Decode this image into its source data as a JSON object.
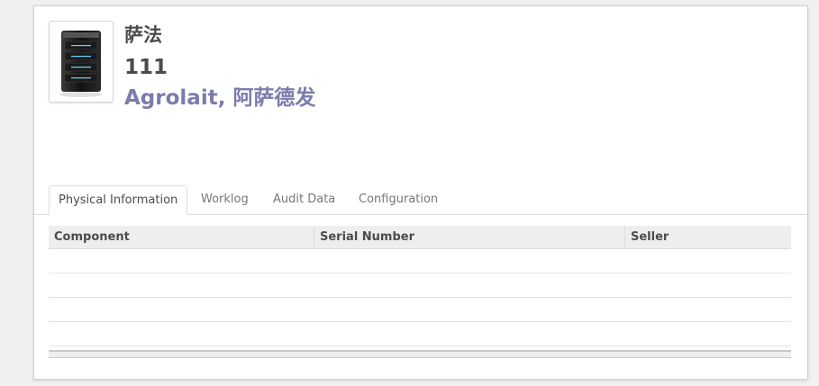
{
  "record": {
    "name": "萨法",
    "code": "111",
    "partner": "Agrolait, 阿萨德发",
    "image_icon": "server-tower-icon"
  },
  "tabs": [
    {
      "label": "Physical Information",
      "active": true
    },
    {
      "label": "Worklog",
      "active": false
    },
    {
      "label": "Audit Data",
      "active": false
    },
    {
      "label": "Configuration",
      "active": false
    }
  ],
  "grid": {
    "columns": [
      "Component",
      "Serial Number",
      "Seller"
    ],
    "rows": [
      [],
      [],
      [],
      []
    ]
  },
  "colors": {
    "partner_link": "#7c7bad",
    "header_text": "#4c4c4c",
    "grid_header_bg": "#eeeeee"
  }
}
